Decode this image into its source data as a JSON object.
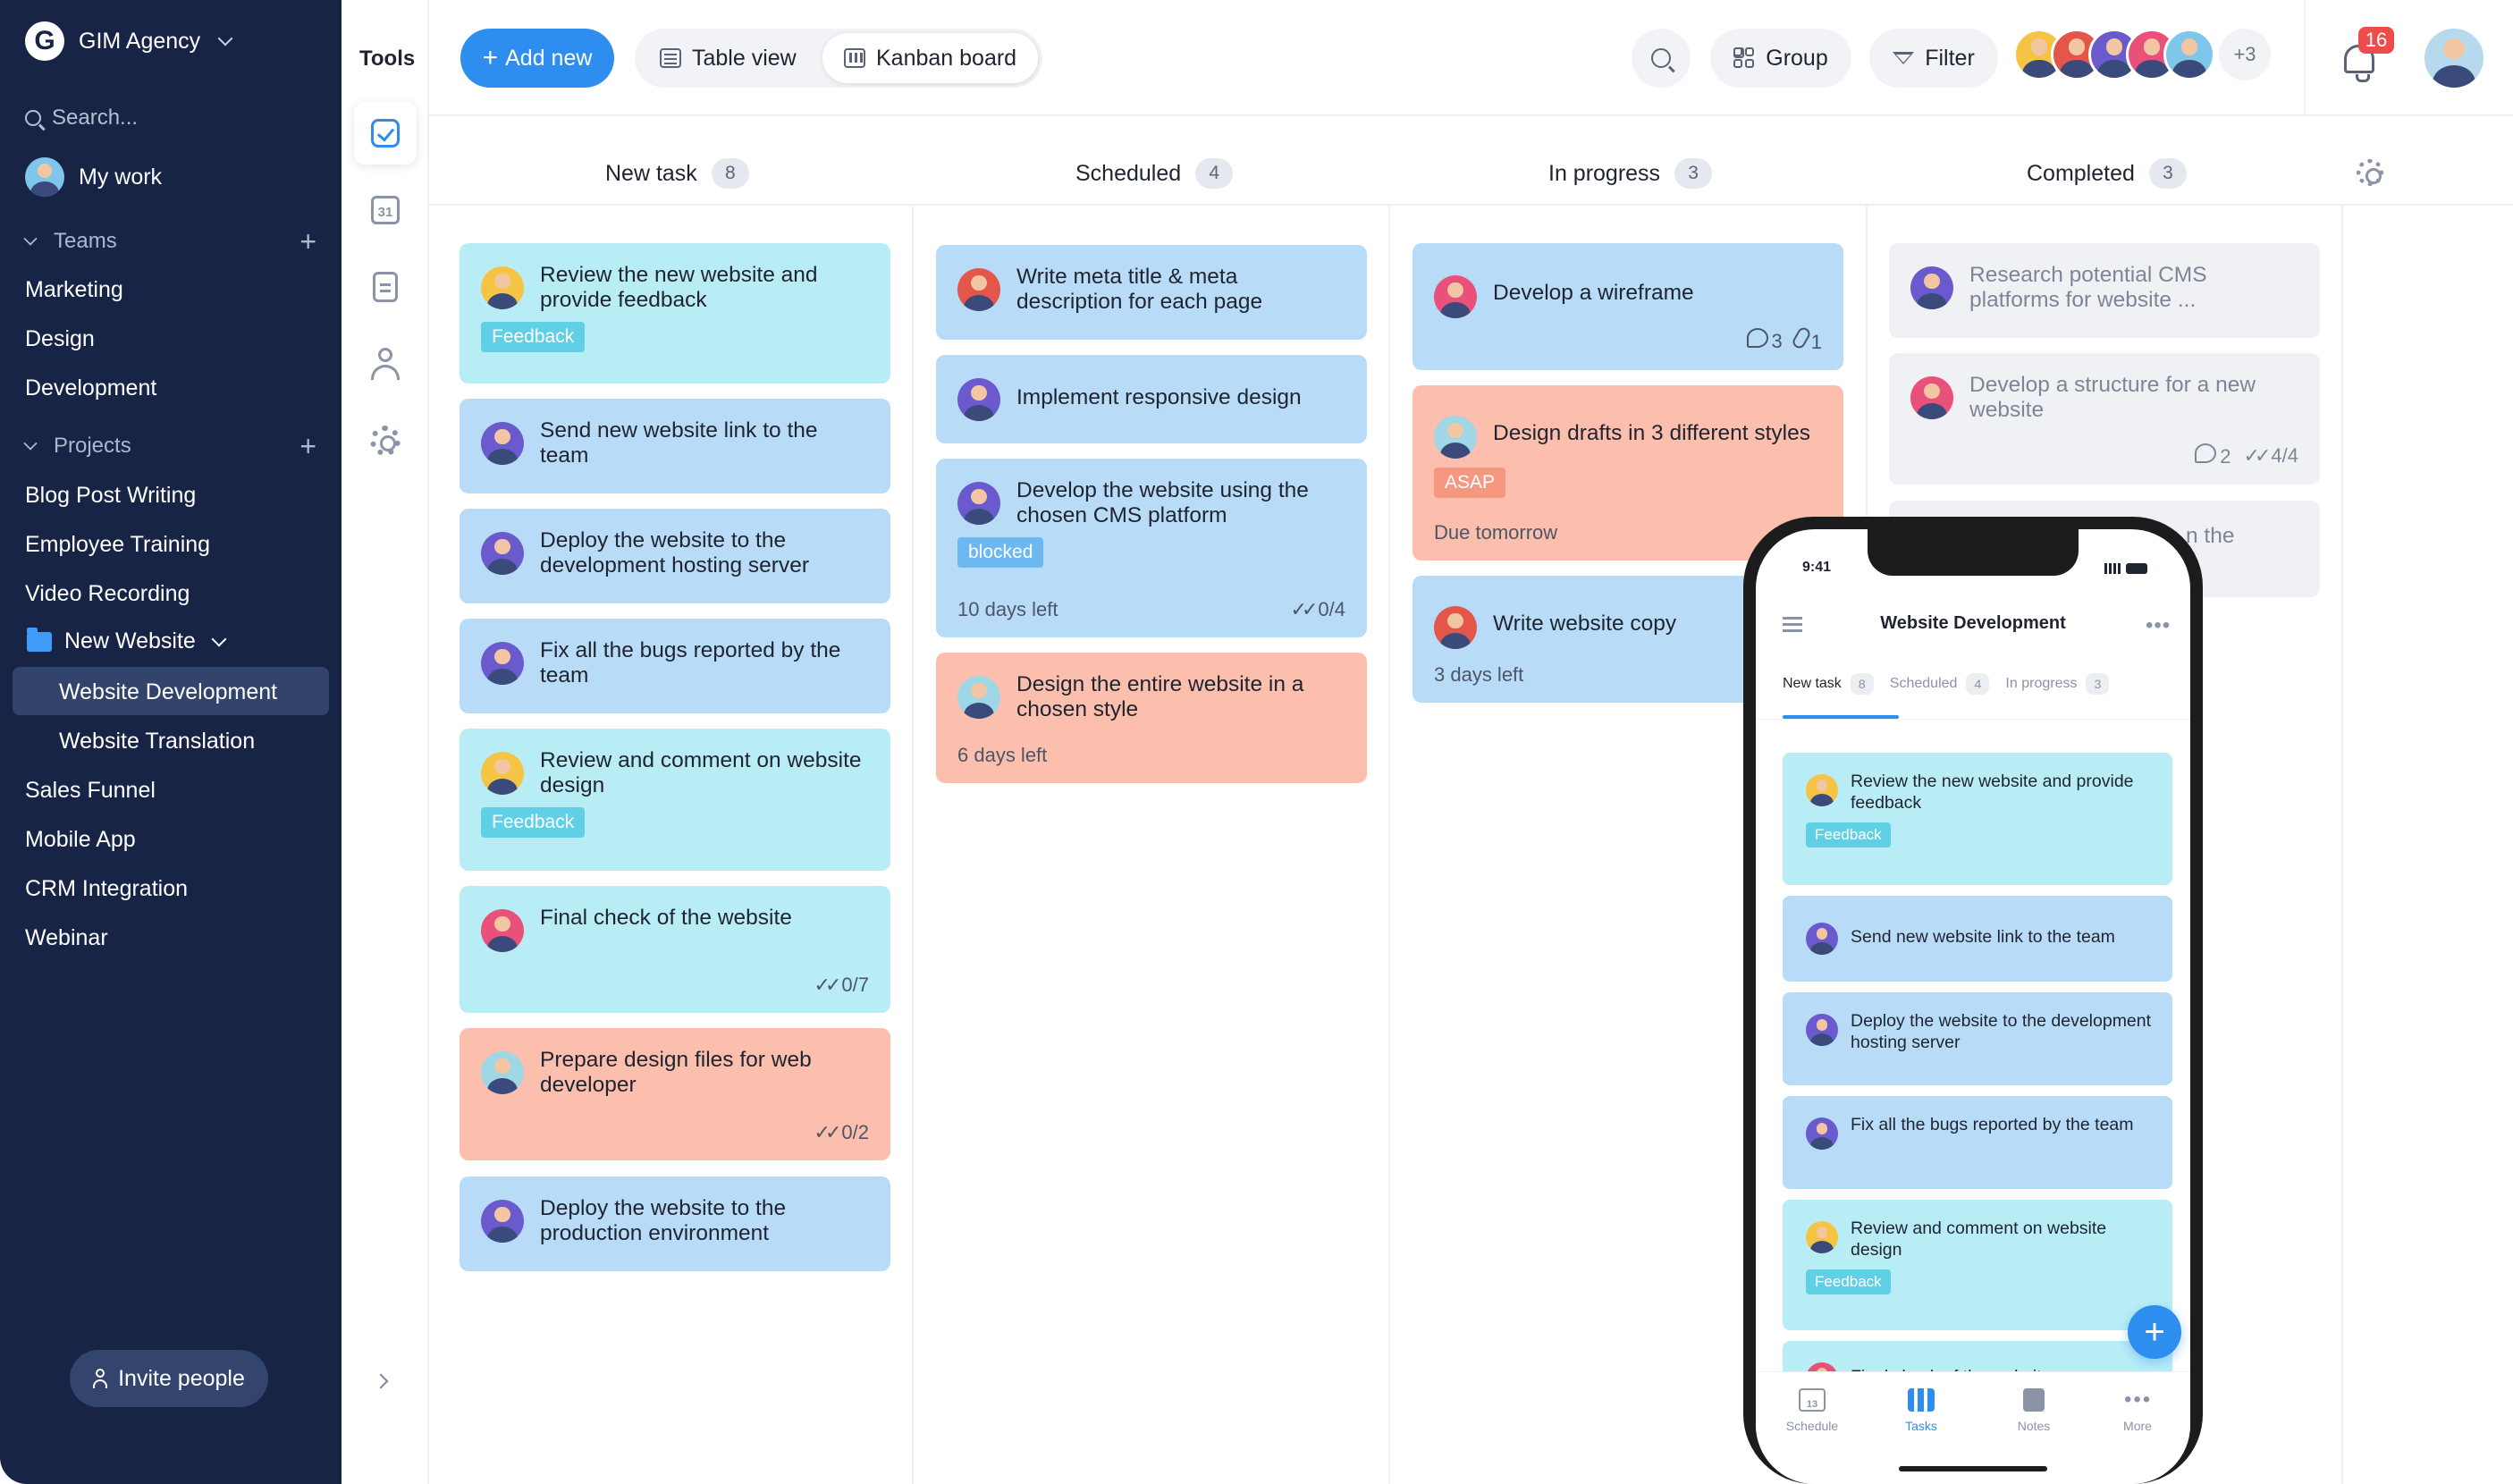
{
  "sidebar": {
    "brand": {
      "logo_letter": "G",
      "name": "GIM Agency"
    },
    "search_placeholder": "Search...",
    "my_work": "My work",
    "teams_label": "Teams",
    "teams": [
      "Marketing",
      "Design",
      "Development"
    ],
    "projects_label": "Projects",
    "projects": [
      "Blog Post Writing",
      "Employee Training",
      "Video Recording"
    ],
    "folder": {
      "name": "New Website",
      "children": [
        "Website Development",
        "Website Translation"
      ],
      "active_child": "Website Development"
    },
    "projects_after": [
      "Sales Funnel",
      "Mobile App",
      "CRM Integration",
      "Webinar"
    ],
    "invite_label": "Invite people"
  },
  "tools": {
    "title": "Tools",
    "icons": [
      "tasks-icon",
      "calendar-icon",
      "notes-icon",
      "person-icon",
      "gear-icon"
    ],
    "calendar_day": "31"
  },
  "toolbar": {
    "add_new": "Add new",
    "views": [
      "Table view",
      "Kanban board"
    ],
    "active_view": "Kanban board",
    "group_label": "Group",
    "filter_label": "Filter",
    "extra_members": "+3",
    "notification_count": "16"
  },
  "colors": {
    "sidebar_bg": "#172446",
    "accent": "#2d8ef0",
    "card_cyan": "#b9edf6",
    "card_blue": "#b8dcf7",
    "card_salmon": "#fcbfae",
    "card_grey": "#f0f1f4",
    "badge_red": "#f04b4b"
  },
  "board": {
    "columns": [
      {
        "name": "New task",
        "count": "8",
        "cards": [
          {
            "title": "Review the new website and provide feedback",
            "tag": "Feedback"
          },
          {
            "title": "Send new website link to the team"
          },
          {
            "title": "Deploy the website to the development hosting server"
          },
          {
            "title": "Fix all the bugs reported by the team"
          },
          {
            "title": "Review and comment on website design",
            "tag": "Feedback"
          },
          {
            "title": "Final check of the website",
            "checks": "0/7"
          },
          {
            "title": "Prepare design files for web developer",
            "checks": "0/2"
          },
          {
            "title": "Deploy the website to the production environment"
          }
        ]
      },
      {
        "name": "Scheduled",
        "count": "4",
        "cards": [
          {
            "title": "Write meta title & meta description for each page"
          },
          {
            "title": "Implement responsive design"
          },
          {
            "title": "Develop the website using the chosen CMS platform",
            "tag": "blocked",
            "due": "10 days left",
            "checks": "0/4"
          },
          {
            "title": "Design the entire website in a chosen style",
            "due": "6 days left"
          }
        ]
      },
      {
        "name": "In progress",
        "count": "3",
        "cards": [
          {
            "title": "Develop a wireframe",
            "comments": "3",
            "attachments": "1"
          },
          {
            "title": "Design drafts in 3 different styles",
            "tag": "ASAP",
            "due": "Due tomorrow"
          },
          {
            "title": "Write website copy",
            "due": "3 days left"
          }
        ]
      },
      {
        "name": "Completed",
        "count": "3",
        "cards": [
          {
            "title": "Research potential CMS platforms for website ..."
          },
          {
            "title": "Develop a structure for a new website",
            "comments": "2",
            "checks": "4/4"
          },
          {
            "title_fragment": "n the"
          }
        ]
      }
    ]
  },
  "phone": {
    "time": "9:41",
    "title": "Website Development",
    "tabs": [
      {
        "label": "New task",
        "count": "8"
      },
      {
        "label": "Scheduled",
        "count": "4"
      },
      {
        "label": "In progress",
        "count": "3"
      }
    ],
    "cards": [
      {
        "title": "Review the new website and provide feedback",
        "tag": "Feedback"
      },
      {
        "title": "Send new website link to the team"
      },
      {
        "title": "Deploy the website to the development hosting server"
      },
      {
        "title": "Fix all the bugs reported by the team"
      },
      {
        "title": "Review and comment on website design",
        "tag": "Feedback"
      },
      {
        "title": "Final check of the website"
      }
    ],
    "nav": [
      {
        "label": "Schedule",
        "icon": "calendar-icon",
        "day": "13"
      },
      {
        "label": "Tasks",
        "icon": "tasks-icon"
      },
      {
        "label": "Notes",
        "icon": "notes-icon"
      },
      {
        "label": "More",
        "icon": "more-icon"
      }
    ],
    "active_nav": "Tasks"
  }
}
